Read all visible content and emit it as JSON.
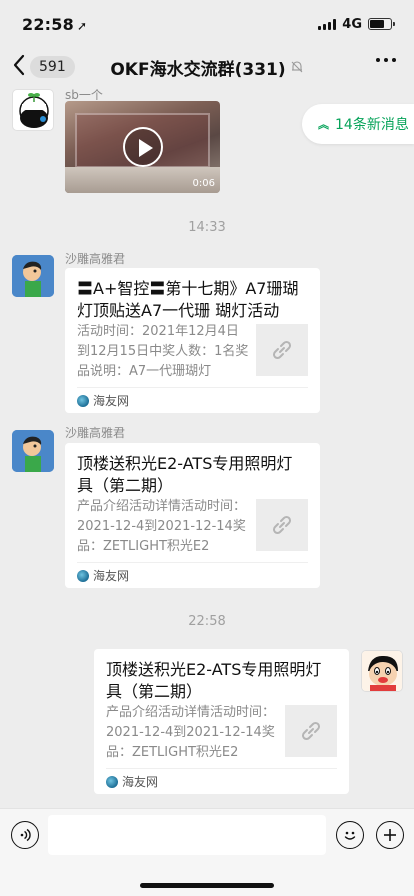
{
  "status_bar": {
    "time": "22:58",
    "location_arrow": "➚",
    "network": "4G"
  },
  "nav": {
    "back_badge": "591",
    "title": "OKF海水交流群(331)",
    "back_icon": "chevron-left-icon",
    "mute_icon": "bell-off-icon",
    "more_icon": "more-dots-icon"
  },
  "new_message_pill": {
    "label": "14条新消息",
    "arrow": "︽"
  },
  "messages": [
    {
      "sender": "sb一个",
      "type": "video",
      "duration": "0:06"
    },
    {
      "type": "time",
      "text": "14:33"
    },
    {
      "sender": "沙雕高雅君",
      "type": "link",
      "title": "〓A+智控〓第十七期》A7珊瑚灯顶贴送A7一代珊 瑚灯活动",
      "desc": "活动时间：2021年12月4日到12月15日中奖人数：1名奖品说明：A7一代珊瑚灯",
      "source": "海友网"
    },
    {
      "sender": "沙雕高雅君",
      "type": "link",
      "title": "顶楼送积光E2-ATS专用照明灯具（第二期）",
      "desc": "产品介绍活动详情活动时间：2021-12-4到2021-12-14奖品：ZETLIGHT积光E2",
      "source": "海友网"
    },
    {
      "type": "time",
      "text": "22:58"
    },
    {
      "sender": "me",
      "type": "link",
      "title": "顶楼送积光E2-ATS专用照明灯具（第二期）",
      "desc": "产品介绍活动详情活动时间：2021-12-4到2021-12-14奖品：ZETLIGHT积光E2",
      "source": "海友网"
    }
  ],
  "input_bar": {
    "voice_icon": "voice-icon",
    "emoji_icon": "emoji-icon",
    "plus_icon": "plus-icon",
    "placeholder": ""
  },
  "colors": {
    "accent_green": "#07a35a",
    "background": "#ededed",
    "bubble": "#ffffff"
  }
}
